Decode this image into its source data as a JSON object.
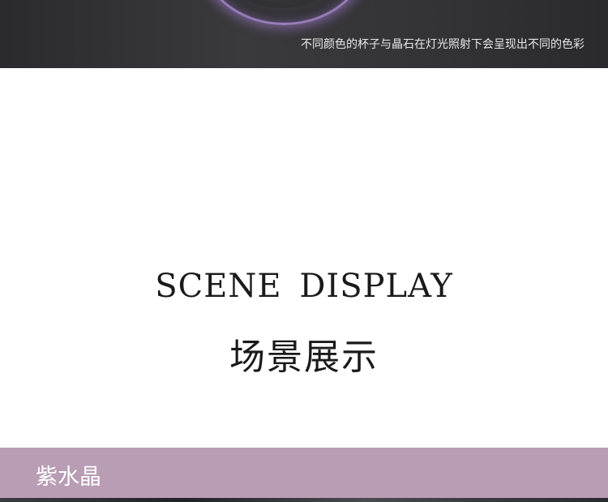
{
  "top_banner": {
    "caption": "不同颜色的杯子与晶石在灯光照射下会呈现出不同的色彩"
  },
  "section": {
    "title_en": "SCENE DISPLAY",
    "title_cn": "场景展示"
  },
  "label_bar": {
    "label": "紫水晶",
    "color": "#b89db5"
  }
}
